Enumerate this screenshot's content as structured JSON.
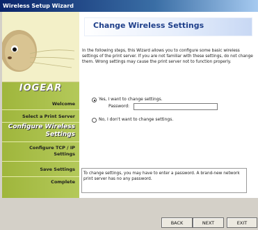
{
  "window": {
    "title": "Wireless Setup Wizard"
  },
  "sidebar": {
    "logo": "IOGEAR",
    "items": [
      {
        "label": "Welcome"
      },
      {
        "label": "Select a Print Server"
      },
      {
        "label": "Configure Wireless Settings"
      },
      {
        "label": "Configure TCP / IP Settings"
      },
      {
        "label": "Save Settings"
      },
      {
        "label": "Complete"
      }
    ]
  },
  "main": {
    "heading": "Change Wireless Settings",
    "intro": "In the following steps, this Wizard allows you to configure some basic wireless settings of the print server. If you are not familiar with these settings, do not change them. Wrong settings may cause the print server not to function properly.",
    "option_yes": "Yes, I want to change settings.",
    "password_label": "Password:",
    "password_value": "",
    "option_no": "No, I don't want to change settings.",
    "selected_option": "yes",
    "info": "To change settings, you may have to enter a password. A brand-new network print server has no any password."
  },
  "buttons": {
    "back": "BACK",
    "next": "NEXT",
    "exit": "EXIT"
  },
  "colors": {
    "sidebar_green": "#9fb63c",
    "heading_blue": "#1e3f8a",
    "titlebar": "#0a246a"
  }
}
